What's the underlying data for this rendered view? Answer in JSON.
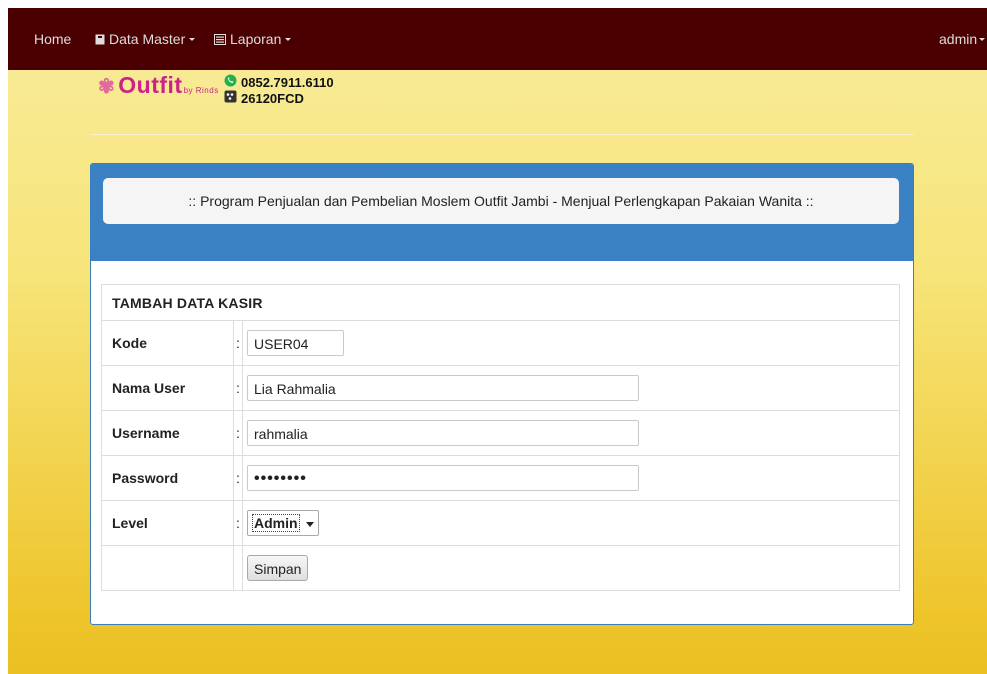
{
  "navbar": {
    "home_label": "Home",
    "menus": [
      {
        "label": "Data Master",
        "icon": "book-icon"
      },
      {
        "label": "Laporan",
        "icon": "list-icon"
      }
    ],
    "user_menu_label": "admin"
  },
  "brand": {
    "logo_text": "Outfit",
    "logo_byline": "by Rinds",
    "phone": "0852.7911.6110",
    "pin": "26120FCD",
    "phone_icon": "whatsapp-icon",
    "pin_icon": "bbm-icon"
  },
  "panel": {
    "banner_text": ":: Program Penjualan dan Pembelian Moslem Outfit Jambi - Menjual Perlengkapan Pakaian Wanita ::"
  },
  "form": {
    "title": "TAMBAH DATA KASIR",
    "colon": ":",
    "fields": {
      "kode": {
        "label": "Kode",
        "value": "USER04"
      },
      "nama": {
        "label": "Nama User",
        "value": "Lia Rahmalia"
      },
      "username": {
        "label": "Username",
        "value": "rahmalia"
      },
      "password": {
        "label": "Password",
        "value": "••••••••"
      },
      "level": {
        "label": "Level",
        "value": "Admin"
      }
    },
    "submit_label": "Simpan"
  },
  "colors": {
    "navbar_bg": "#4a0000",
    "panel_heading": "#3a82c4",
    "page_bg_top": "#f8ec9c",
    "page_bg_bottom": "#eac022"
  }
}
